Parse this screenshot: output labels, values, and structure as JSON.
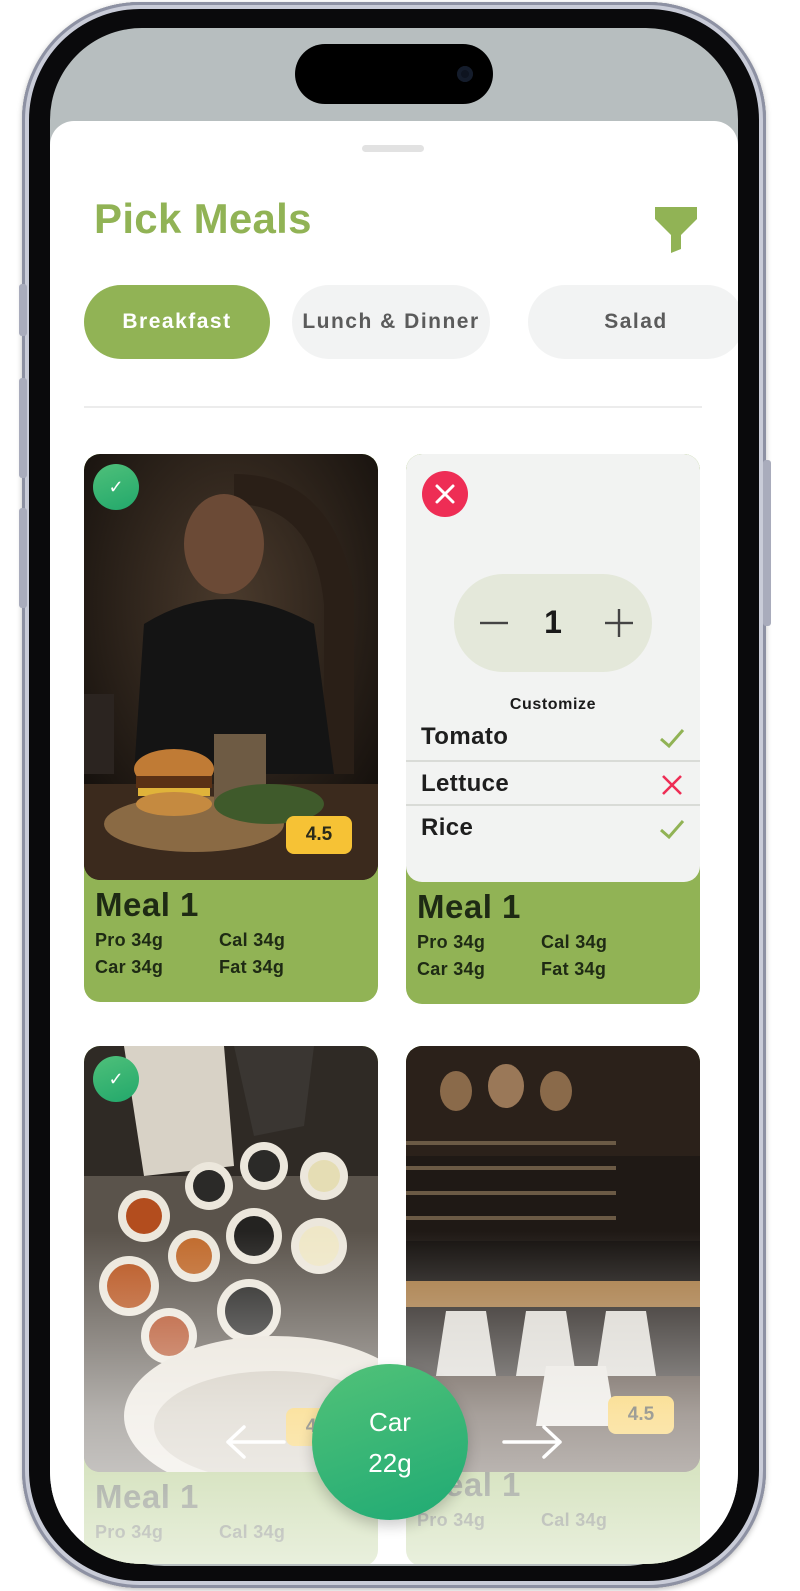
{
  "header": {
    "title": "Pick Meals",
    "filter_icon": "filter-icon"
  },
  "tabs": [
    {
      "label": "Breakfast",
      "active": true
    },
    {
      "label": "Lunch & Dinner",
      "active": false
    },
    {
      "label": "Salad",
      "active": false
    }
  ],
  "meals": [
    {
      "name": "Meal 1",
      "rating": "4.5",
      "selected": true,
      "macros": {
        "pro": "Pro 34g",
        "cal": "Cal 34g",
        "car": "Car 34g",
        "fat": "Fat 34g"
      }
    },
    {
      "name": "Meal 1",
      "macros": {
        "pro": "Pro 34g",
        "cal": "Cal 34g",
        "car": "Car 34g",
        "fat": "Fat 34g"
      },
      "customize": {
        "quantity": "1",
        "label": "Customize",
        "options": [
          {
            "name": "Tomato",
            "included": true
          },
          {
            "name": "Lettuce",
            "included": false
          },
          {
            "name": "Rice",
            "included": true
          }
        ]
      }
    },
    {
      "name": "Meal 1",
      "rating": "4.5",
      "selected": true,
      "macros": {
        "pro": "Pro 34g",
        "cal": "Cal 34g"
      }
    },
    {
      "name": "Meal 1",
      "rating": "4.5",
      "selected": false,
      "macros": {
        "pro": "Pro 34g",
        "cal": "Cal 34g"
      }
    }
  ],
  "macro_switcher": {
    "label": "Car",
    "value": "22g"
  },
  "colors": {
    "accent": "#91b355",
    "fab": "#2bb272",
    "remove": "#ee2d55",
    "rating": "#f6c235"
  }
}
